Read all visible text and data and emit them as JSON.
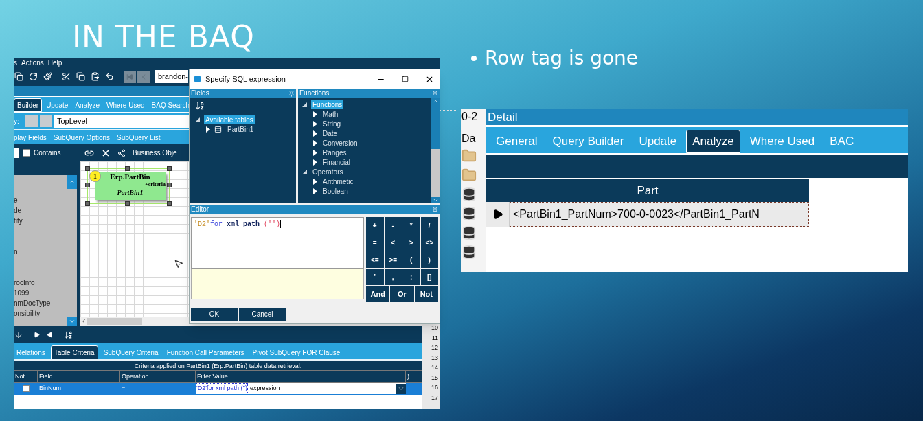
{
  "slide": {
    "title": "IN THE BAQ",
    "bullets": [
      "Row tag is gone"
    ]
  },
  "baq_window": {
    "menu": [
      "s",
      "Actions",
      "Help"
    ],
    "toolbar_field": "brandon-",
    "tabs": [
      {
        "label": "Builder",
        "selected": true
      },
      {
        "label": "Update",
        "selected": false
      },
      {
        "label": "Analyze",
        "selected": false
      },
      {
        "label": "Where Used",
        "selected": false
      },
      {
        "label": "BAQ Search",
        "selected": false
      }
    ],
    "subquery_label": "y:",
    "subquery_value": "TopLevel",
    "subtabs": [
      "play Fields",
      "SubQuery Options",
      "SubQuery List"
    ],
    "filter": {
      "checked": false,
      "label": "Contains"
    },
    "table_list": [
      "e",
      "de",
      "tity",
      "n",
      "rocInfo",
      "1099",
      "nmDocType",
      "onsibility"
    ],
    "diagram_toolbar_label": "Business Obje",
    "table_node": {
      "number": "1",
      "table": "Erp.PartBin",
      "note": "+criteria",
      "alias": "PartBin1",
      "selected": true
    },
    "bottom_tabs": [
      {
        "label": "Relations",
        "selected": false
      },
      {
        "label": "Table Criteria",
        "selected": true
      },
      {
        "label": "SubQuery Criteria",
        "selected": false
      },
      {
        "label": "Function Call Parameters",
        "selected": false
      },
      {
        "label": "Pivot SubQuery FOR Clause",
        "selected": false
      }
    ],
    "criteria": {
      "caption": "Criteria applied on PartBin1 (Erp.PartBin)  table data retrieval.",
      "columns": [
        "Not",
        "Field",
        "Operation",
        "Filter Value",
        ")"
      ],
      "rows": [
        {
          "not": false,
          "field": "BinNum",
          "operation": "=",
          "filter_value": "'D2'for xml path ('')",
          "filter_kind": "expression",
          "selected": true
        }
      ]
    },
    "line_numbers": [
      "10",
      "11",
      "12",
      "13",
      "14",
      "15",
      "16",
      "17"
    ]
  },
  "sql_dialog": {
    "title": "Specify SQL expression",
    "fields": {
      "header": "Fields",
      "tree": [
        {
          "label": "Available tables",
          "expanded": true,
          "selected": true,
          "children": [
            {
              "label": "PartBin1",
              "expanded": false,
              "selected": false
            }
          ]
        }
      ]
    },
    "functions": {
      "header": "Functions",
      "tree": [
        {
          "label": "Functions",
          "expanded": true,
          "selected": true,
          "children": [
            {
              "label": "Math",
              "expanded": false,
              "selected": false
            },
            {
              "label": "String",
              "expanded": false,
              "selected": false
            },
            {
              "label": "Date",
              "expanded": false,
              "selected": false
            },
            {
              "label": "Conversion",
              "expanded": false,
              "selected": false
            },
            {
              "label": "Ranges",
              "expanded": false,
              "selected": false
            },
            {
              "label": "Financial",
              "expanded": false,
              "selected": false
            }
          ]
        },
        {
          "label": "Operators",
          "expanded": true,
          "selected": false,
          "children": [
            {
              "label": "Arithmetic",
              "expanded": false,
              "selected": false
            },
            {
              "label": "Boolean",
              "expanded": false,
              "selected": false
            }
          ]
        }
      ]
    },
    "editor": {
      "header": "Editor",
      "tokens": [
        {
          "text": "'D2'",
          "kind": "string"
        },
        {
          "text": "for",
          "kind": "keyword"
        },
        {
          "text": " xml path ",
          "kind": "plain"
        },
        {
          "text": "('')",
          "kind": "punct"
        }
      ],
      "operators": [
        "+",
        "-",
        "*",
        "/",
        "=",
        "<",
        ">",
        "<>",
        "<=",
        ">=",
        "(",
        ")",
        "'",
        ",",
        ":",
        "[]"
      ],
      "logic": [
        "And",
        "Or",
        "Not"
      ]
    },
    "buttons": [
      "OK",
      "Cancel"
    ]
  },
  "detail_window": {
    "left_cut": "0-2",
    "left_label": "Da",
    "title": "Detail",
    "tabs": [
      {
        "label": "General",
        "selected": false
      },
      {
        "label": "Query Builder",
        "selected": false
      },
      {
        "label": "Update",
        "selected": false
      },
      {
        "label": "Analyze",
        "selected": true
      },
      {
        "label": "Where Used",
        "selected": false
      },
      {
        "label": "BAC",
        "selected": false
      }
    ],
    "results": {
      "column": "Part",
      "rows": [
        {
          "value": "<PartBin1_PartNum>700-0-0023</PartBin1_PartN",
          "selected": true
        }
      ]
    }
  }
}
